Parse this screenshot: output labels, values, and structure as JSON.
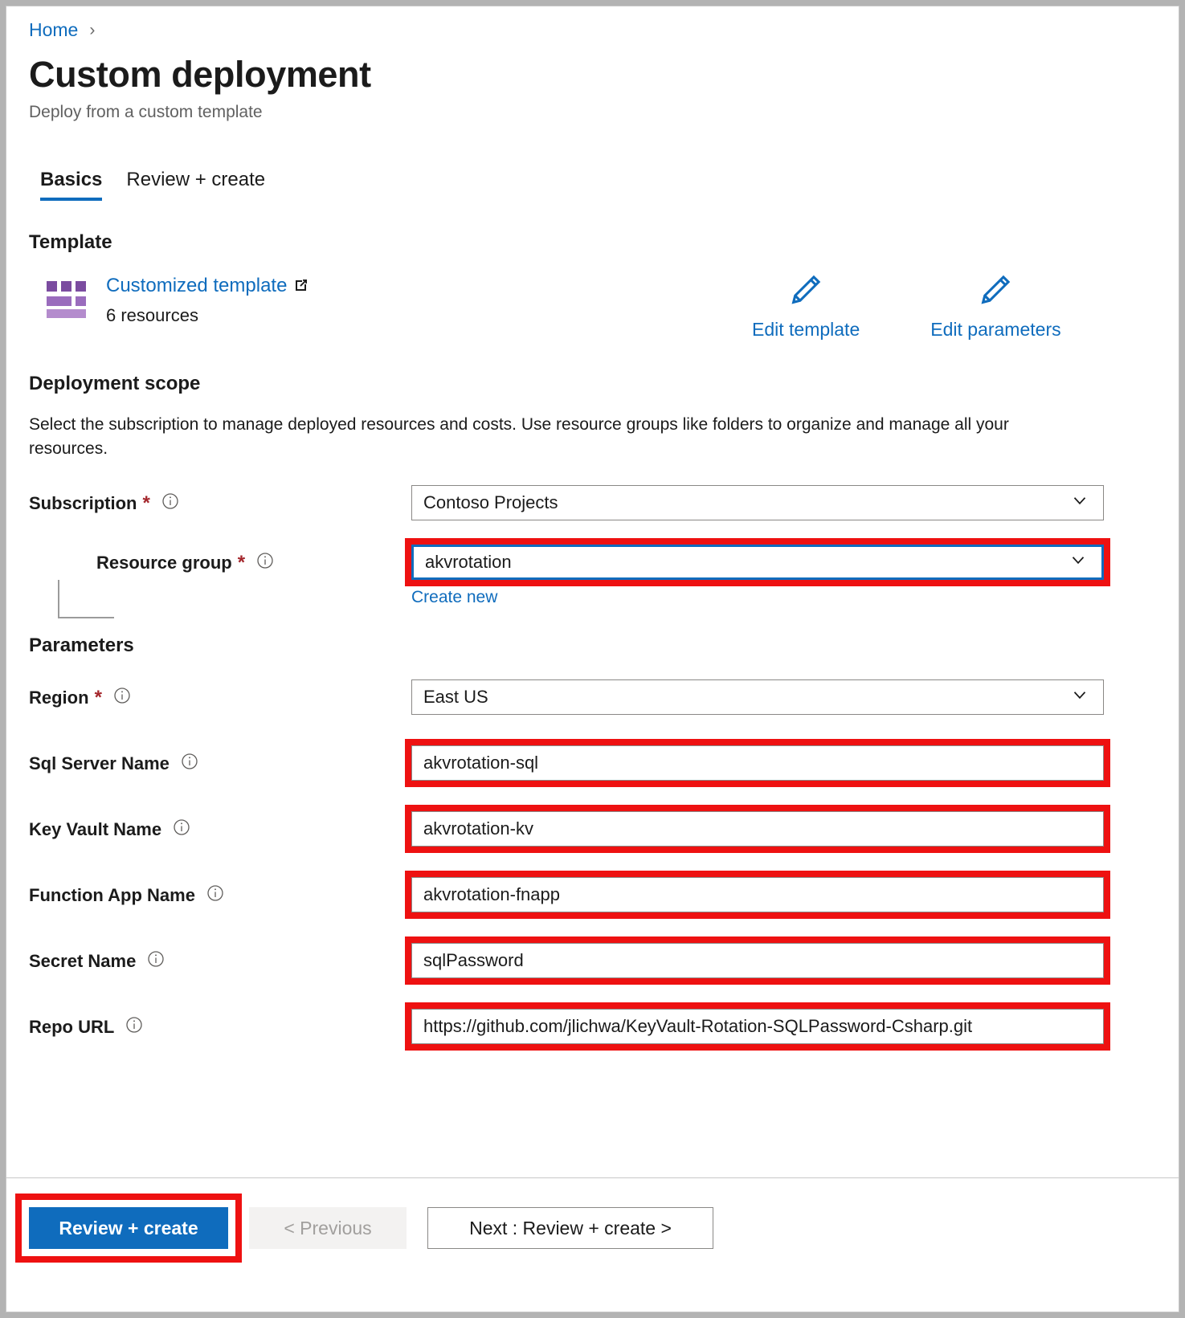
{
  "breadcrumb": {
    "home": "Home",
    "separator": "›"
  },
  "header": {
    "title": "Custom deployment",
    "subtitle": "Deploy from a custom template"
  },
  "tabs": [
    {
      "label": "Basics",
      "active": true
    },
    {
      "label": "Review + create",
      "active": false
    }
  ],
  "template": {
    "heading": "Template",
    "link_label": "Customized template",
    "resource_count": "6 resources",
    "actions": [
      {
        "label": "Edit template",
        "icon": "pencil-icon"
      },
      {
        "label": "Edit parameters",
        "icon": "pencil-icon"
      }
    ]
  },
  "deployment_scope": {
    "heading": "Deployment scope",
    "description": "Select the subscription to manage deployed resources and costs. Use resource groups like folders to organize and manage all your resources.",
    "subscription": {
      "label": "Subscription",
      "required": "*",
      "value": "Contoso Projects",
      "control": "dropdown"
    },
    "resource_group": {
      "label": "Resource group",
      "required": "*",
      "value": "akvrotation",
      "control": "dropdown",
      "create_new": "Create new",
      "highlighted": true,
      "focused": true
    }
  },
  "parameters": {
    "heading": "Parameters",
    "fields": [
      {
        "label": "Region",
        "required": "*",
        "value": "East US",
        "control": "dropdown",
        "highlighted": false
      },
      {
        "label": "Sql Server Name",
        "required": "",
        "value": "akvrotation-sql",
        "control": "text",
        "highlighted": true
      },
      {
        "label": "Key Vault Name",
        "required": "",
        "value": "akvrotation-kv",
        "control": "text",
        "highlighted": true
      },
      {
        "label": "Function App Name",
        "required": "",
        "value": "akvrotation-fnapp",
        "control": "text",
        "highlighted": true
      },
      {
        "label": "Secret Name",
        "required": "",
        "value": "sqlPassword",
        "control": "text",
        "highlighted": true
      },
      {
        "label": "Repo URL",
        "required": "",
        "value": "https://github.com/jlichwa/KeyVault-Rotation-SQLPassword-Csharp.git",
        "control": "text",
        "highlighted": true
      }
    ]
  },
  "footer": {
    "review_create": "Review + create",
    "previous": "< Previous",
    "next": "Next : Review + create >"
  },
  "colors": {
    "accent_blue": "#0f6cbd",
    "highlight_red": "#ee1111",
    "required_red": "#a4262c",
    "template_purple": "#7b4ca0"
  }
}
